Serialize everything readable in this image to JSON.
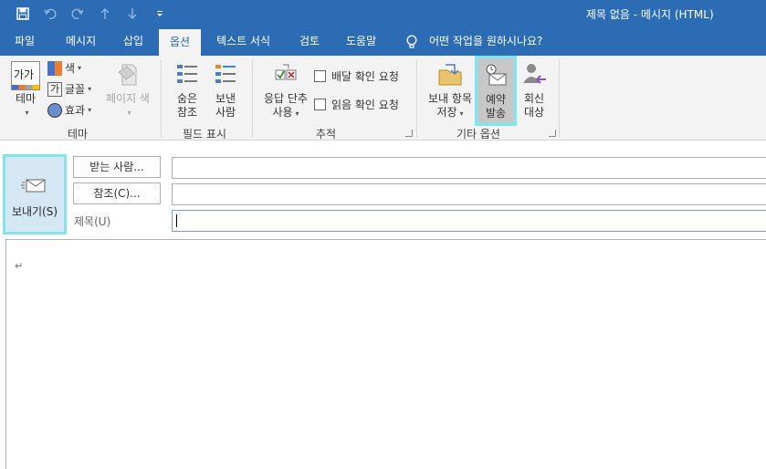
{
  "window": {
    "title": "제목 없음  -  메시지 (HTML)"
  },
  "qat": {
    "icons": [
      "save-icon",
      "undo-icon",
      "redo-icon",
      "up-arrow-icon",
      "down-arrow-icon",
      "customize-qat-icon"
    ]
  },
  "tabs": [
    {
      "label": "파일"
    },
    {
      "label": "메시지"
    },
    {
      "label": "삽입"
    },
    {
      "label": "옵션",
      "active": true
    },
    {
      "label": "텍스트 서식"
    },
    {
      "label": "검토"
    },
    {
      "label": "도움말"
    }
  ],
  "tell_me": {
    "text": "어떤 작업을 원하시나요?"
  },
  "ribbon": {
    "theme_group": {
      "label": "테마",
      "theme_btn": "테마",
      "theme_icon_text": "가가",
      "colors": "색",
      "fonts": "글꼴",
      "fonts_icon_text": "가",
      "effects": "효과",
      "page_color": "페이지 색"
    },
    "fields_group": {
      "label": "필드 표시",
      "bcc_line1": "숨은",
      "bcc_line2": "참조",
      "from_line1": "보낸",
      "from_line2": "사람"
    },
    "tracking_group": {
      "label": "추적",
      "voting_line1": "응답 단추",
      "voting_line2": "사용",
      "delivery_receipt": "배달 확인 요청",
      "read_receipt": "읽음 확인 요청"
    },
    "more_group": {
      "label": "기타 옵션",
      "save_sent_line1": "보내 항목",
      "save_sent_line2": "저장",
      "delay_line1": "예약",
      "delay_line2": "발송",
      "reply_line1": "회신",
      "reply_line2": "대상"
    }
  },
  "compose": {
    "send": "보내기(S)",
    "to_btn": "받는 사람...",
    "cc_btn": "참조(C)...",
    "subject_label": "제목(U)",
    "to_value": "",
    "cc_value": "",
    "subject_value": "",
    "paragraph_mark": "↵"
  },
  "colors": {
    "accent": "#2b6cb5",
    "highlight": "#7ee6ee",
    "send_bg": "#d5e6f5"
  }
}
